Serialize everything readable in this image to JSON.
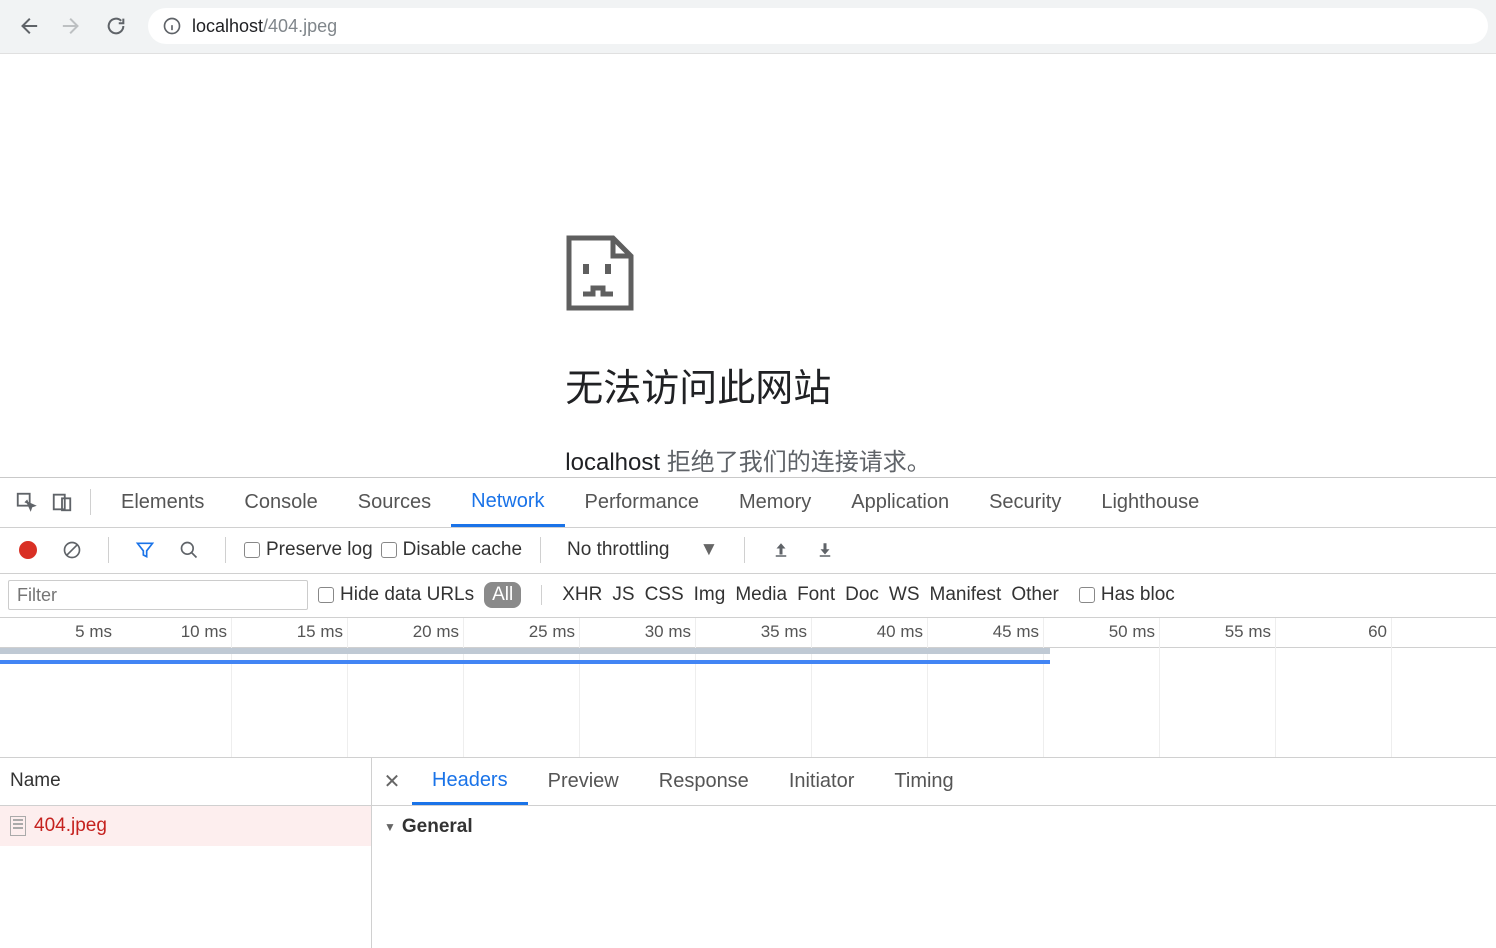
{
  "browser": {
    "url_host": "localhost",
    "url_path": "/404.jpeg"
  },
  "page": {
    "error_title": "无法访问此网站",
    "error_host": "localhost",
    "error_rest": " 拒绝了我们的连接请求。"
  },
  "devtools": {
    "tabs": [
      "Elements",
      "Console",
      "Sources",
      "Network",
      "Performance",
      "Memory",
      "Application",
      "Security",
      "Lighthouse"
    ],
    "active_tab": "Network"
  },
  "network_toolbar": {
    "preserve_log": "Preserve log",
    "disable_cache": "Disable cache",
    "throttling": "No throttling"
  },
  "filter_row": {
    "placeholder": "Filter",
    "hide_data_urls": "Hide data URLs",
    "types": [
      "All",
      "XHR",
      "JS",
      "CSS",
      "Img",
      "Media",
      "Font",
      "Doc",
      "WS",
      "Manifest",
      "Other"
    ],
    "active_type": "All",
    "has_block": "Has bloc"
  },
  "timeline": {
    "ticks": [
      "5 ms",
      "10 ms",
      "15 ms",
      "20 ms",
      "25 ms",
      "30 ms",
      "35 ms",
      "40 ms",
      "45 ms",
      "50 ms",
      "55 ms",
      "60"
    ]
  },
  "requests": {
    "header": "Name",
    "rows": [
      "404.jpeg"
    ]
  },
  "detail": {
    "tabs": [
      "Headers",
      "Preview",
      "Response",
      "Initiator",
      "Timing"
    ],
    "active_tab": "Headers",
    "section": "General"
  }
}
